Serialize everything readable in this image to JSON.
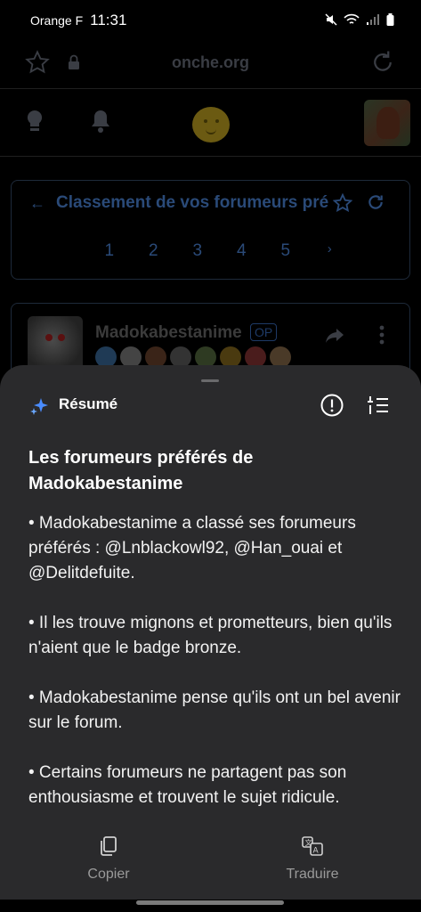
{
  "status_bar": {
    "carrier": "Orange F",
    "time": "11:31"
  },
  "browser": {
    "url": "onche.org"
  },
  "ranking": {
    "title": "Classement de vos forumeurs pré",
    "pages": [
      "1",
      "2",
      "3",
      "4",
      "5"
    ],
    "next": "›"
  },
  "post": {
    "username": "Madokabestanime",
    "op_badge": "OP"
  },
  "sheet": {
    "label": "Résumé",
    "title": "Les forumeurs préférés de Madokabestanime",
    "bullets": [
      "• Madokabestanime a classé ses forumeurs préférés : @Lnblackowl92, @Han_ouai et @Delitdefuite.",
      "• Il les trouve mignons et prometteurs, bien qu'ils n'aient que le badge bronze.",
      "• Madokabestanime pense qu'ils ont un bel avenir sur le forum.",
      "• Certains forumeurs ne partagent pas son enthousiasme et trouvent le sujet ridicule."
    ],
    "copy_label": "Copier",
    "translate_label": "Traduire"
  },
  "colors": {
    "sheet_bg": "#2a2a2c",
    "link_dim": "#2a4a78",
    "sparkle": "#4a8cff"
  }
}
